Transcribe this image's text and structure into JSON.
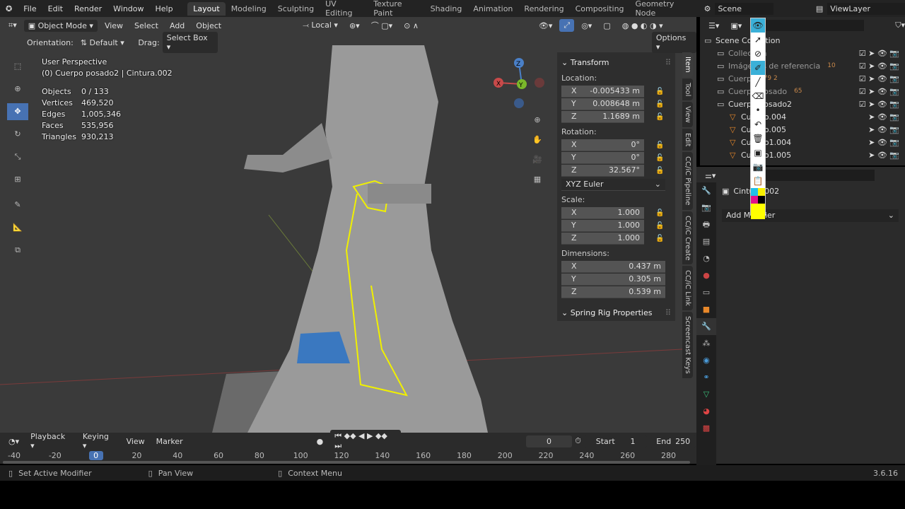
{
  "menu": {
    "items": [
      "File",
      "Edit",
      "Render",
      "Window",
      "Help"
    ]
  },
  "workspaces": [
    "Layout",
    "Modeling",
    "Sculpting",
    "UV Editing",
    "Texture Paint",
    "Shading",
    "Animation",
    "Rendering",
    "Compositing",
    "Geometry Node"
  ],
  "active_workspace": "Layout",
  "scene": "Scene",
  "view_layer": "ViewLayer",
  "viewport_header": {
    "mode": "Object Mode",
    "menus": [
      "View",
      "Select",
      "Add",
      "Object"
    ],
    "transform_orientation": "Local"
  },
  "tool_settings": {
    "orientation_label": "Orientation:",
    "orientation": "Default",
    "drag_label": "Drag:",
    "drag": "Select Box",
    "options": "Options"
  },
  "overlay": {
    "perspective": "User Perspective",
    "context": "(0) Cuerpo posado2 | Cintura.002",
    "stats": [
      {
        "k": "Objects",
        "v": "0 / 133"
      },
      {
        "k": "Vertices",
        "v": "469,520"
      },
      {
        "k": "Edges",
        "v": "1,005,346"
      },
      {
        "k": "Faces",
        "v": "535,956"
      },
      {
        "k": "Triangles",
        "v": "930,213"
      }
    ]
  },
  "gizmo": {
    "x": "X",
    "y": "Y",
    "z": "Z"
  },
  "npanel": {
    "title": "Transform",
    "location_label": "Location:",
    "location": [
      "-0.005433 m",
      "0.008648 m",
      "1.1689 m"
    ],
    "rotation_label": "Rotation:",
    "rotation": [
      "0°",
      "0°",
      "32.567°"
    ],
    "rotation_mode": "XYZ Euler",
    "scale_label": "Scale:",
    "scale": [
      "1.000",
      "1.000",
      "1.000"
    ],
    "dimensions_label": "Dimensions:",
    "dimensions": [
      "0.437 m",
      "0.305 m",
      "0.539 m"
    ],
    "axes": [
      "X",
      "Y",
      "Z"
    ],
    "spring_rig": "Spring Rig Properties",
    "tabs": [
      "Item",
      "Tool",
      "View",
      "Edit",
      "CC/iC Pipeline",
      "CC/iC Create",
      "CC/iC Link",
      "Screencast Keys"
    ]
  },
  "outliner": {
    "rows": [
      {
        "name": "Scene Collection",
        "indent": 0
      },
      {
        "name": "Collection",
        "indent": 1
      },
      {
        "name": "Imágenes de referencia",
        "indent": 1,
        "badge": "10"
      },
      {
        "name": "Cuerpo",
        "indent": 1,
        "badge": "79  2"
      },
      {
        "name": "Cuerpo posado",
        "indent": 1,
        "badge": "65"
      },
      {
        "name": "Cuerpo posado2",
        "indent": 1
      },
      {
        "name": "Cuerpo.004",
        "indent": 2
      },
      {
        "name": "Cuerpo.005",
        "indent": 2
      },
      {
        "name": "Cuerpo1.004",
        "indent": 2
      },
      {
        "name": "Cuerpo1.005",
        "indent": 2
      }
    ]
  },
  "properties": {
    "object": "Cintura.002",
    "add_modifier": "Add Modifier"
  },
  "timeline": {
    "menus": [
      "Playback",
      "Keying",
      "View",
      "Marker"
    ],
    "current_frame": "0",
    "start_label": "Start",
    "start": "1",
    "end_label": "End",
    "end": "250",
    "ticks": [
      "-40",
      "-20",
      "0",
      "20",
      "40",
      "60",
      "80",
      "100",
      "120",
      "140",
      "160",
      "180",
      "200",
      "220",
      "240",
      "260",
      "280"
    ]
  },
  "status": {
    "left": "Set Active Modifier",
    "middle": "Pan View",
    "right": "Context Menu",
    "version": "3.6.16"
  },
  "colors": {
    "accent": "#4772b3",
    "selection_outline": "#f0f000",
    "active_tab": "#3ab0d8"
  }
}
